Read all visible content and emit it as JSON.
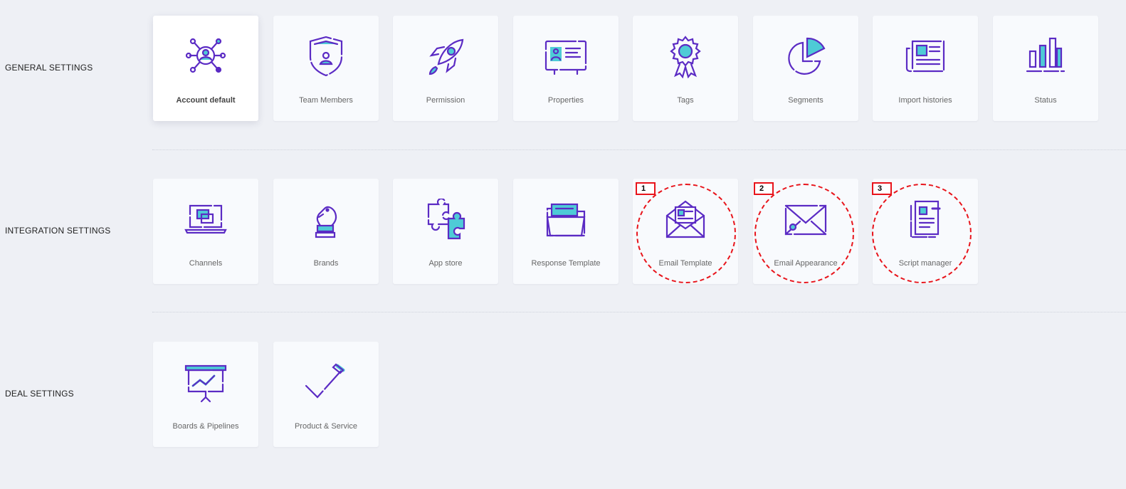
{
  "sections": [
    {
      "label": "GENERAL SETTINGS",
      "cards": [
        {
          "label": "Account default",
          "icon": "account-network-icon"
        },
        {
          "label": "Team Members",
          "icon": "shield-user-icon"
        },
        {
          "label": "Permission",
          "icon": "rocket-icon"
        },
        {
          "label": "Properties",
          "icon": "id-card-icon"
        },
        {
          "label": "Tags",
          "icon": "award-ribbon-icon"
        },
        {
          "label": "Segments",
          "icon": "pie-chart-icon"
        },
        {
          "label": "Import histories",
          "icon": "newspaper-icon"
        },
        {
          "label": "Status",
          "icon": "bar-chart-icon"
        }
      ]
    },
    {
      "label": "INTEGRATION SETTINGS",
      "cards": [
        {
          "label": "Channels",
          "icon": "laptop-icon"
        },
        {
          "label": "Brands",
          "icon": "chess-knight-icon"
        },
        {
          "label": "App store",
          "icon": "puzzle-icon"
        },
        {
          "label": "Response Template",
          "icon": "folder-icon"
        },
        {
          "label": "Email Template",
          "icon": "open-envelope-icon"
        },
        {
          "label": "Email Appearance",
          "icon": "envelope-icon"
        },
        {
          "label": "Script manager",
          "icon": "document-icon"
        }
      ]
    },
    {
      "label": "DEAL SETTINGS",
      "cards": [
        {
          "label": "Boards & Pipelines",
          "icon": "presentation-board-icon"
        },
        {
          "label": "Product & Service",
          "icon": "checkmark-pen-icon"
        }
      ]
    }
  ],
  "annotations": [
    "1",
    "2",
    "3"
  ],
  "colors": {
    "icon_stroke": "#5b2bc4",
    "icon_fill": "#4ecbd6",
    "marker": "#e8141b",
    "background": "#eef0f5"
  }
}
